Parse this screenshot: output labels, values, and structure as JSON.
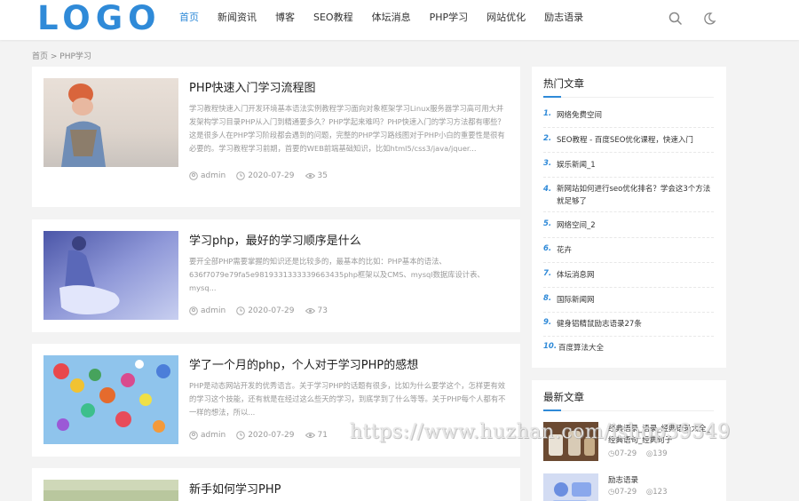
{
  "header": {
    "logo": "LOGO",
    "nav": [
      "首页",
      "新闻资讯",
      "博客",
      "SEO教程",
      "体坛消息",
      "PHP学习",
      "网站优化",
      "励志语录"
    ]
  },
  "breadcrumb": "首页 > PHP学习",
  "articles": [
    {
      "title": "PHP快速入门学习流程图",
      "desc": "学习教程快速入门开发环境基本语法实例教程学习面向对象框架学习Linux服务器学习高可用大并发架构学习目录PHP从入门到精通要多久？PHP学起来难吗？PHP快速入门的学习方法都有哪些？这是很多人在PHP学习阶段都会遇到的问题，完整的PHP学习路线图对于PHP小白的重要性是很有必要的。学习教程学习前期，首要的WEB前端基础知识，比如html5/css3/java/jquer...",
      "author": "admin",
      "date": "2020-07-29",
      "views": "35"
    },
    {
      "title": "学习php，最好的学习顺序是什么",
      "desc": "要开全部PHP需要掌握的知识还是比较多的，最基本的比如：PHP基本的语法、636f7079e79fa5e9819331333339663435php框架以及CMS、mysql数据库设计表、mysq...",
      "author": "admin",
      "date": "2020-07-29",
      "views": "73"
    },
    {
      "title": "学了一个月的php，个人对于学习PHP的感想",
      "desc": "PHP是动态网站开发的优秀语言。关于学习PHP的话题有很多，比如为什么要学这个，怎样更有效的学习这个技能，还有就是在经过这么些天的学习，到底学到了什么等等。关于PHP每个人都有不一样的想法，所以...",
      "author": "admin",
      "date": "2020-07-29",
      "views": "71"
    },
    {
      "title": "新手如何学习PHP"
    }
  ],
  "hot": {
    "title": "热门文章",
    "items": [
      {
        "num": "1.",
        "text": "网络免费空间"
      },
      {
        "num": "2.",
        "text": "SEO教程 - 百度SEO优化课程，快速入门"
      },
      {
        "num": "3.",
        "text": "娱乐新闻_1"
      },
      {
        "num": "4.",
        "text": "新网站如何进行seo优化排名？学会这3个方法就足够了"
      },
      {
        "num": "5.",
        "text": "网络空间_2"
      },
      {
        "num": "6.",
        "text": "花卉"
      },
      {
        "num": "7.",
        "text": "体坛消息网"
      },
      {
        "num": "8.",
        "text": "国际新闻网"
      },
      {
        "num": "9.",
        "text": "健身铝精鼠励志语录27条"
      },
      {
        "num": "10.",
        "text": "百度算法大全"
      }
    ]
  },
  "latest": {
    "title": "最新文章",
    "items": [
      {
        "title": "经典语录_语录_经典语录大全_经典语句_经典句子",
        "date": "07-29",
        "views": "139"
      },
      {
        "title": "励志语录",
        "date": "07-29",
        "views": "123"
      }
    ]
  },
  "watermark": "https://www.huzhan.com/ishop39549",
  "colors": {
    "accent": "#2f8ad8"
  }
}
